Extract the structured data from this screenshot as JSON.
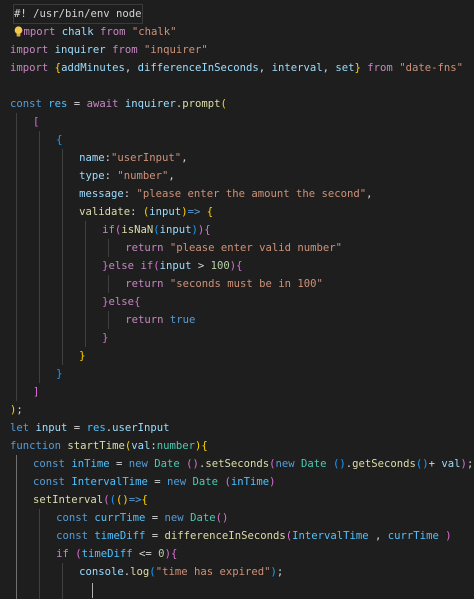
{
  "editor": {
    "theme": {
      "background": "#1e1e1e",
      "keyword": "#569cd6",
      "control": "#c586c0",
      "function": "#dcdcaa",
      "variable": "#9cdcfe",
      "string": "#ce9178",
      "number": "#b5cea8",
      "bracket1": "#ffd700",
      "bracket2": "#da70d6",
      "bracket3": "#179fff"
    },
    "lightbulb_icon": "lightbulb-icon",
    "lines": [
      {
        "indent": 0,
        "tokens": [
          {
            "t": "#! /usr/bin/env node",
            "c": "pn"
          }
        ]
      },
      {
        "indent": 0,
        "tokens": [
          {
            "t": "mport",
            "c": "ctl"
          },
          {
            "t": " chalk ",
            "c": "vr"
          },
          {
            "t": "from",
            "c": "ctl"
          },
          {
            "t": " ",
            "c": "pn"
          },
          {
            "t": "\"chalk\"",
            "c": "st"
          }
        ]
      },
      {
        "indent": 0,
        "tokens": [
          {
            "t": "import",
            "c": "ctl"
          },
          {
            "t": " inquirer ",
            "c": "vr"
          },
          {
            "t": "from",
            "c": "ctl"
          },
          {
            "t": " ",
            "c": "pn"
          },
          {
            "t": "\"inquirer\"",
            "c": "st"
          }
        ]
      },
      {
        "indent": 0,
        "tokens": [
          {
            "t": "import",
            "c": "ctl"
          },
          {
            "t": " ",
            "c": "pn"
          },
          {
            "t": "{",
            "c": "b1"
          },
          {
            "t": "addMinutes",
            "c": "vr"
          },
          {
            "t": ", ",
            "c": "pn"
          },
          {
            "t": "differenceInSeconds",
            "c": "vr"
          },
          {
            "t": ", ",
            "c": "pn"
          },
          {
            "t": "interval",
            "c": "vr"
          },
          {
            "t": ", ",
            "c": "pn"
          },
          {
            "t": "set",
            "c": "vr"
          },
          {
            "t": "}",
            "c": "b1"
          },
          {
            "t": " ",
            "c": "pn"
          },
          {
            "t": "from",
            "c": "ctl"
          },
          {
            "t": " ",
            "c": "pn"
          },
          {
            "t": "\"date-fns\"",
            "c": "st"
          }
        ]
      },
      {
        "indent": 0,
        "tokens": []
      },
      {
        "indent": 0,
        "tokens": [
          {
            "t": "const",
            "c": "kw"
          },
          {
            "t": " ",
            "c": "pn"
          },
          {
            "t": "res",
            "c": "cn"
          },
          {
            "t": " = ",
            "c": "pn"
          },
          {
            "t": "await",
            "c": "ctl"
          },
          {
            "t": " ",
            "c": "pn"
          },
          {
            "t": "inquirer",
            "c": "vr"
          },
          {
            "t": ".",
            "c": "pn"
          },
          {
            "t": "prompt",
            "c": "fn"
          },
          {
            "t": "(",
            "c": "b1"
          }
        ]
      },
      {
        "indent": 1,
        "tokens": [
          {
            "t": "[",
            "c": "b2"
          }
        ]
      },
      {
        "indent": 2,
        "tokens": [
          {
            "t": "{",
            "c": "b3"
          }
        ]
      },
      {
        "indent": 3,
        "tokens": [
          {
            "t": "name",
            "c": "vr"
          },
          {
            "t": ":",
            "c": "pn"
          },
          {
            "t": "\"userInput\"",
            "c": "st"
          },
          {
            "t": ",",
            "c": "pn"
          }
        ]
      },
      {
        "indent": 3,
        "tokens": [
          {
            "t": "type",
            "c": "vr"
          },
          {
            "t": ": ",
            "c": "pn"
          },
          {
            "t": "\"number\"",
            "c": "st"
          },
          {
            "t": ",",
            "c": "pn"
          }
        ]
      },
      {
        "indent": 3,
        "tokens": [
          {
            "t": "message",
            "c": "vr"
          },
          {
            "t": ": ",
            "c": "pn"
          },
          {
            "t": "\"please enter the amount the second\"",
            "c": "st"
          },
          {
            "t": ",",
            "c": "pn"
          }
        ]
      },
      {
        "indent": 3,
        "tokens": [
          {
            "t": "validate",
            "c": "fn"
          },
          {
            "t": ": ",
            "c": "pn"
          },
          {
            "t": "(",
            "c": "b1"
          },
          {
            "t": "input",
            "c": "vr"
          },
          {
            "t": ")",
            "c": "b1"
          },
          {
            "t": "=> ",
            "c": "kw"
          },
          {
            "t": "{",
            "c": "b1"
          }
        ]
      },
      {
        "indent": 4,
        "tokens": [
          {
            "t": "if",
            "c": "ctl"
          },
          {
            "t": "(",
            "c": "b2"
          },
          {
            "t": "isNaN",
            "c": "fn"
          },
          {
            "t": "(",
            "c": "b3"
          },
          {
            "t": "input",
            "c": "vr"
          },
          {
            "t": ")",
            "c": "b3"
          },
          {
            "t": ")",
            "c": "b2"
          },
          {
            "t": "{",
            "c": "b2"
          }
        ]
      },
      {
        "indent": 5,
        "tokens": [
          {
            "t": "return",
            "c": "ctl"
          },
          {
            "t": " ",
            "c": "pn"
          },
          {
            "t": "\"please enter valid number\"",
            "c": "st"
          }
        ]
      },
      {
        "indent": 4,
        "tokens": [
          {
            "t": "}",
            "c": "b2"
          },
          {
            "t": "else",
            "c": "ctl"
          },
          {
            "t": " ",
            "c": "pn"
          },
          {
            "t": "if",
            "c": "ctl"
          },
          {
            "t": "(",
            "c": "b2"
          },
          {
            "t": "input",
            "c": "vr"
          },
          {
            "t": " > ",
            "c": "pn"
          },
          {
            "t": "100",
            "c": "nu"
          },
          {
            "t": ")",
            "c": "b2"
          },
          {
            "t": "{",
            "c": "b2"
          }
        ]
      },
      {
        "indent": 5,
        "tokens": [
          {
            "t": "return",
            "c": "ctl"
          },
          {
            "t": " ",
            "c": "pn"
          },
          {
            "t": "\"seconds must be in 100\"",
            "c": "st"
          }
        ]
      },
      {
        "indent": 4,
        "tokens": [
          {
            "t": "}",
            "c": "b2"
          },
          {
            "t": "else",
            "c": "ctl"
          },
          {
            "t": "{",
            "c": "b2"
          }
        ]
      },
      {
        "indent": 5,
        "tokens": [
          {
            "t": "return",
            "c": "ctl"
          },
          {
            "t": " ",
            "c": "pn"
          },
          {
            "t": "true",
            "c": "kw"
          }
        ]
      },
      {
        "indent": 4,
        "tokens": [
          {
            "t": "}",
            "c": "b2"
          }
        ]
      },
      {
        "indent": 3,
        "tokens": [
          {
            "t": "}",
            "c": "b1"
          }
        ]
      },
      {
        "indent": 2,
        "tokens": [
          {
            "t": "}",
            "c": "b3"
          }
        ]
      },
      {
        "indent": 1,
        "tokens": [
          {
            "t": "]",
            "c": "b2"
          }
        ]
      },
      {
        "indent": 0,
        "tokens": [
          {
            "t": ")",
            "c": "b1"
          },
          {
            "t": ";",
            "c": "pn"
          }
        ]
      },
      {
        "indent": 0,
        "tokens": [
          {
            "t": "let",
            "c": "kw"
          },
          {
            "t": " ",
            "c": "pn"
          },
          {
            "t": "input",
            "c": "vr"
          },
          {
            "t": " = ",
            "c": "pn"
          },
          {
            "t": "res",
            "c": "cn"
          },
          {
            "t": ".",
            "c": "pn"
          },
          {
            "t": "userInput",
            "c": "vr"
          }
        ]
      },
      {
        "indent": 0,
        "tokens": [
          {
            "t": "function",
            "c": "kw"
          },
          {
            "t": " ",
            "c": "pn"
          },
          {
            "t": "startTime",
            "c": "fn"
          },
          {
            "t": "(",
            "c": "b1"
          },
          {
            "t": "val",
            "c": "vr"
          },
          {
            "t": ":",
            "c": "pn"
          },
          {
            "t": "number",
            "c": "ty"
          },
          {
            "t": ")",
            "c": "b1"
          },
          {
            "t": "{",
            "c": "b1"
          }
        ]
      },
      {
        "indent": 1,
        "tokens": [
          {
            "t": "const",
            "c": "kw"
          },
          {
            "t": " ",
            "c": "pn"
          },
          {
            "t": "inTime",
            "c": "cn"
          },
          {
            "t": " = ",
            "c": "pn"
          },
          {
            "t": "new",
            "c": "kw"
          },
          {
            "t": " ",
            "c": "pn"
          },
          {
            "t": "Date",
            "c": "ty"
          },
          {
            "t": " ",
            "c": "pn"
          },
          {
            "t": "()",
            "c": "b2"
          },
          {
            "t": ".",
            "c": "pn"
          },
          {
            "t": "setSeconds",
            "c": "fn"
          },
          {
            "t": "(",
            "c": "b2"
          },
          {
            "t": "new",
            "c": "kw"
          },
          {
            "t": " ",
            "c": "pn"
          },
          {
            "t": "Date",
            "c": "ty"
          },
          {
            "t": " ",
            "c": "pn"
          },
          {
            "t": "()",
            "c": "b3"
          },
          {
            "t": ".",
            "c": "pn"
          },
          {
            "t": "getSeconds",
            "c": "fn"
          },
          {
            "t": "()",
            "c": "b3"
          },
          {
            "t": "+ ",
            "c": "pn"
          },
          {
            "t": "val",
            "c": "vr"
          },
          {
            "t": ")",
            "c": "b2"
          },
          {
            "t": ";",
            "c": "pn"
          }
        ]
      },
      {
        "indent": 1,
        "tokens": [
          {
            "t": "const",
            "c": "kw"
          },
          {
            "t": " ",
            "c": "pn"
          },
          {
            "t": "IntervalTime",
            "c": "cn"
          },
          {
            "t": " = ",
            "c": "pn"
          },
          {
            "t": "new",
            "c": "kw"
          },
          {
            "t": " ",
            "c": "pn"
          },
          {
            "t": "Date",
            "c": "ty"
          },
          {
            "t": " ",
            "c": "pn"
          },
          {
            "t": "(",
            "c": "b2"
          },
          {
            "t": "inTime",
            "c": "cn"
          },
          {
            "t": ")",
            "c": "b2"
          }
        ]
      },
      {
        "indent": 1,
        "tokens": [
          {
            "t": "setInterval",
            "c": "fn"
          },
          {
            "t": "(",
            "c": "b2"
          },
          {
            "t": "(",
            "c": "b3"
          },
          {
            "t": "()",
            "c": "b1"
          },
          {
            "t": "=>",
            "c": "kw"
          },
          {
            "t": "{",
            "c": "b1"
          }
        ]
      },
      {
        "indent": 2,
        "tokens": [
          {
            "t": "const",
            "c": "kw"
          },
          {
            "t": " ",
            "c": "pn"
          },
          {
            "t": "currTime",
            "c": "cn"
          },
          {
            "t": " = ",
            "c": "pn"
          },
          {
            "t": "new",
            "c": "kw"
          },
          {
            "t": " ",
            "c": "pn"
          },
          {
            "t": "Date",
            "c": "ty"
          },
          {
            "t": "()",
            "c": "b2"
          }
        ]
      },
      {
        "indent": 2,
        "tokens": [
          {
            "t": "const",
            "c": "kw"
          },
          {
            "t": " ",
            "c": "pn"
          },
          {
            "t": "timeDiff",
            "c": "cn"
          },
          {
            "t": " = ",
            "c": "pn"
          },
          {
            "t": "differenceInSeconds",
            "c": "fn"
          },
          {
            "t": "(",
            "c": "b2"
          },
          {
            "t": "IntervalTime",
            "c": "cn"
          },
          {
            "t": " , ",
            "c": "pn"
          },
          {
            "t": "currTime",
            "c": "cn"
          },
          {
            "t": " ",
            "c": "pn"
          },
          {
            "t": ")",
            "c": "b2"
          }
        ]
      },
      {
        "indent": 2,
        "tokens": [
          {
            "t": "if",
            "c": "ctl"
          },
          {
            "t": " ",
            "c": "pn"
          },
          {
            "t": "(",
            "c": "b2"
          },
          {
            "t": "timeDiff",
            "c": "cn"
          },
          {
            "t": " <= ",
            "c": "pn"
          },
          {
            "t": "0",
            "c": "nu"
          },
          {
            "t": ")",
            "c": "b2"
          },
          {
            "t": "{",
            "c": "b2"
          }
        ]
      },
      {
        "indent": 3,
        "tokens": [
          {
            "t": "console",
            "c": "vr"
          },
          {
            "t": ".",
            "c": "pn"
          },
          {
            "t": "log",
            "c": "fn"
          },
          {
            "t": "(",
            "c": "b3"
          },
          {
            "t": "\"time has expired\"",
            "c": "st"
          },
          {
            "t": ")",
            "c": "b3"
          },
          {
            "t": ";",
            "c": "pn"
          }
        ]
      },
      {
        "indent": 3,
        "tokens": [
          {
            "t": "",
            "c": "pn"
          }
        ]
      }
    ]
  }
}
